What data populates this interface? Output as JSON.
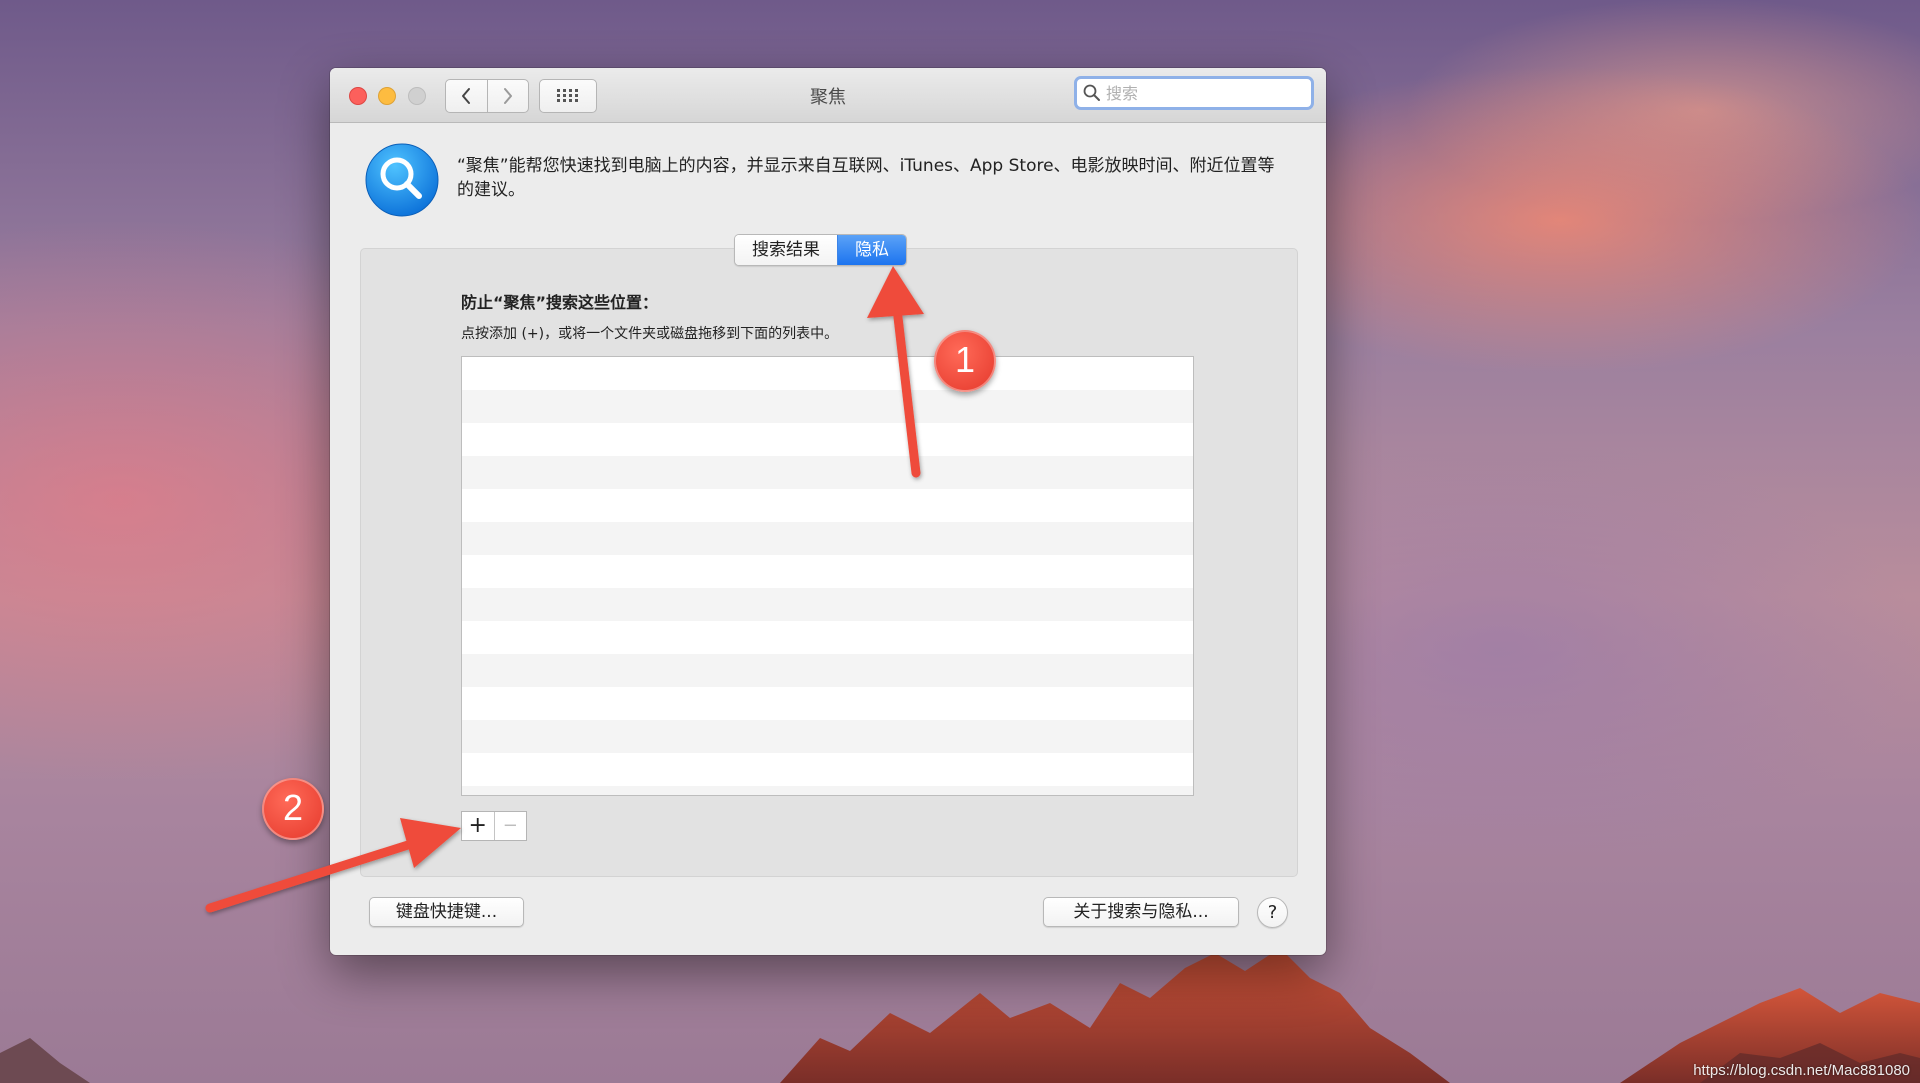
{
  "window": {
    "title": "聚焦",
    "search_placeholder": "搜索"
  },
  "header": {
    "description": "“聚焦”能帮您快速找到电脑上的内容，并显示来自互联网、iTunes、App Store、电影放映时间、附近位置等的建议。"
  },
  "tabs": [
    {
      "label": "搜索结果",
      "active": false
    },
    {
      "label": "隐私",
      "active": true
    }
  ],
  "privacy": {
    "title": "防止“聚焦”搜索这些位置：",
    "hint": "点按添加 (+)，或将一个文件夹或磁盘拖移到下面的列表中。",
    "items": []
  },
  "buttons": {
    "add": "+",
    "remove": "−",
    "keyboard_shortcuts": "键盘快捷键...",
    "about": "关于搜索与隐私...",
    "help": "?"
  },
  "annotations": {
    "badge1": "1",
    "badge2": "2"
  },
  "watermark": "https://blog.csdn.net/Mac881080",
  "colors": {
    "accent": "#1c74ef",
    "annotation": "#e5392c",
    "close": "#fc605c",
    "minimize": "#fdbc40"
  }
}
